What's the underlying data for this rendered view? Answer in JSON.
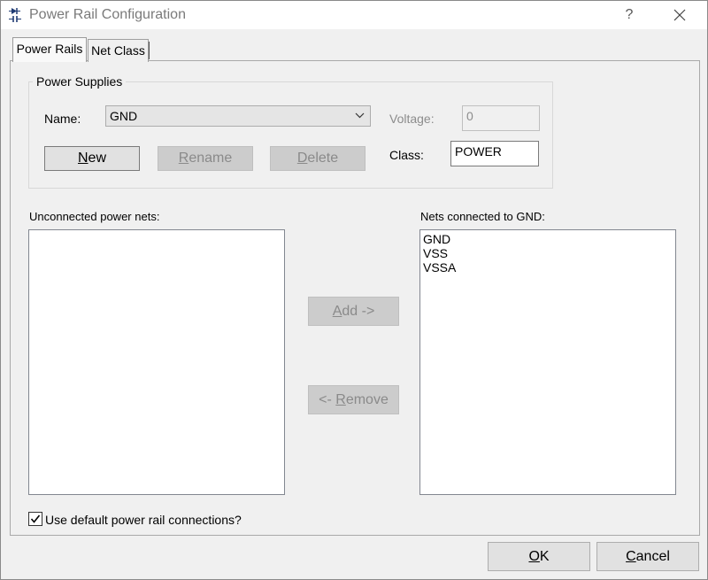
{
  "window": {
    "title": "Power Rail Configuration",
    "help_label": "?"
  },
  "tabs": [
    {
      "label": "Power Rails",
      "active": true
    },
    {
      "label": "Net Class",
      "active": false
    }
  ],
  "power_supplies": {
    "group_label": "Power Supplies",
    "name_label": "Name:",
    "name_value": "GND",
    "voltage_label": "Voltage:",
    "voltage_value": "0",
    "class_label": "Class:",
    "class_value": "POWER",
    "new_button": {
      "pre": "",
      "accel": "N",
      "post": "ew"
    },
    "rename_button": {
      "pre": "",
      "accel": "R",
      "post": "ename"
    },
    "delete_button": {
      "pre": "",
      "accel": "D",
      "post": "elete"
    }
  },
  "unconnected": {
    "label": "Unconnected power nets:",
    "items": []
  },
  "connected": {
    "label": "Nets connected to GND:",
    "items": [
      "GND",
      "VSS",
      "VSSA"
    ]
  },
  "add_button": {
    "pre": "",
    "accel": "A",
    "post": "dd ->"
  },
  "remove_button": {
    "pre": "<- ",
    "accel": "R",
    "post": "emove"
  },
  "default_connections": {
    "label": "Use default power rail connections?",
    "checked": true
  },
  "ok_button": {
    "pre": "",
    "accel": "O",
    "post": "K"
  },
  "cancel_button": {
    "pre": "",
    "accel": "C",
    "post": "ancel"
  }
}
